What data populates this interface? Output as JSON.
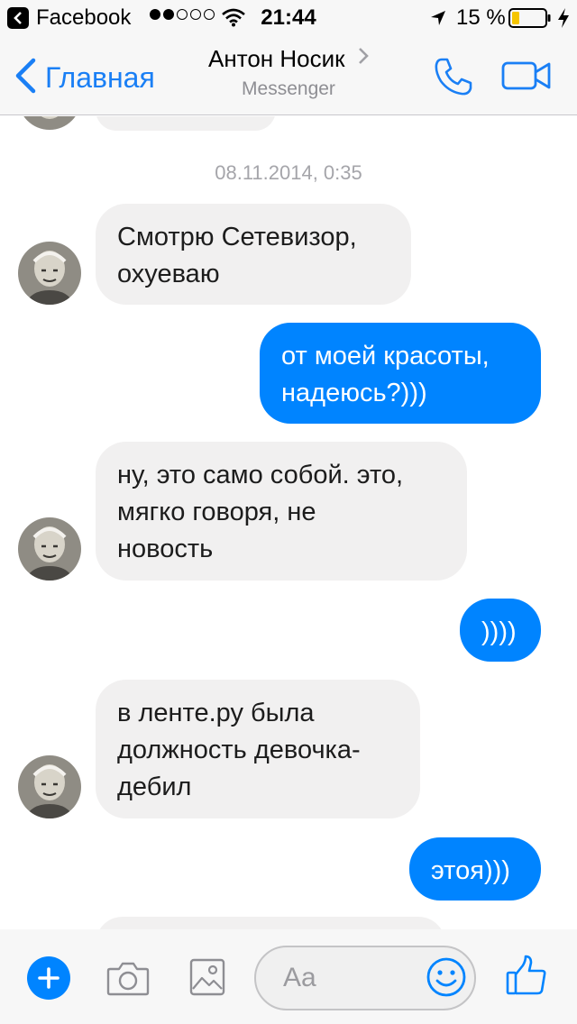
{
  "status_bar": {
    "back_app": "Facebook",
    "time": "21:44",
    "battery": "15 %"
  },
  "header": {
    "back_label": "Главная",
    "title": "Антон Носик",
    "subtitle": "Messenger"
  },
  "conversation": {
    "timestamp": "08.11.2014, 0:35",
    "messages": [
      {
        "direction": "in",
        "lines": [
          "Смотрю Сетевизор,",
          "охуеваю"
        ]
      },
      {
        "direction": "out",
        "lines": [
          "от моей красоты,",
          "надеюсь?)))"
        ]
      },
      {
        "direction": "in",
        "lines": [
          "ну, это само собой. это,",
          "мягко говоря, не",
          "новость"
        ]
      },
      {
        "direction": "out",
        "lines": [
          "))))"
        ]
      },
      {
        "direction": "in",
        "lines": [
          "в ленте.ру была",
          "должность девочка-",
          "дебил"
        ]
      },
      {
        "direction": "out",
        "lines": [
          "этоя)))"
        ]
      }
    ]
  },
  "composer": {
    "placeholder": "Aa"
  },
  "colors": {
    "accent": "#0084ff",
    "incoming_bubble": "#f1f0f0",
    "nav_blue": "#1a7ff5"
  },
  "icons": {
    "nav": [
      "chevron-left-icon",
      "chevron-right-icon",
      "phone-icon",
      "video-camera-icon"
    ],
    "composer": [
      "plus-icon",
      "camera-icon",
      "image-icon",
      "smiley-icon",
      "thumbs-up-icon"
    ]
  }
}
